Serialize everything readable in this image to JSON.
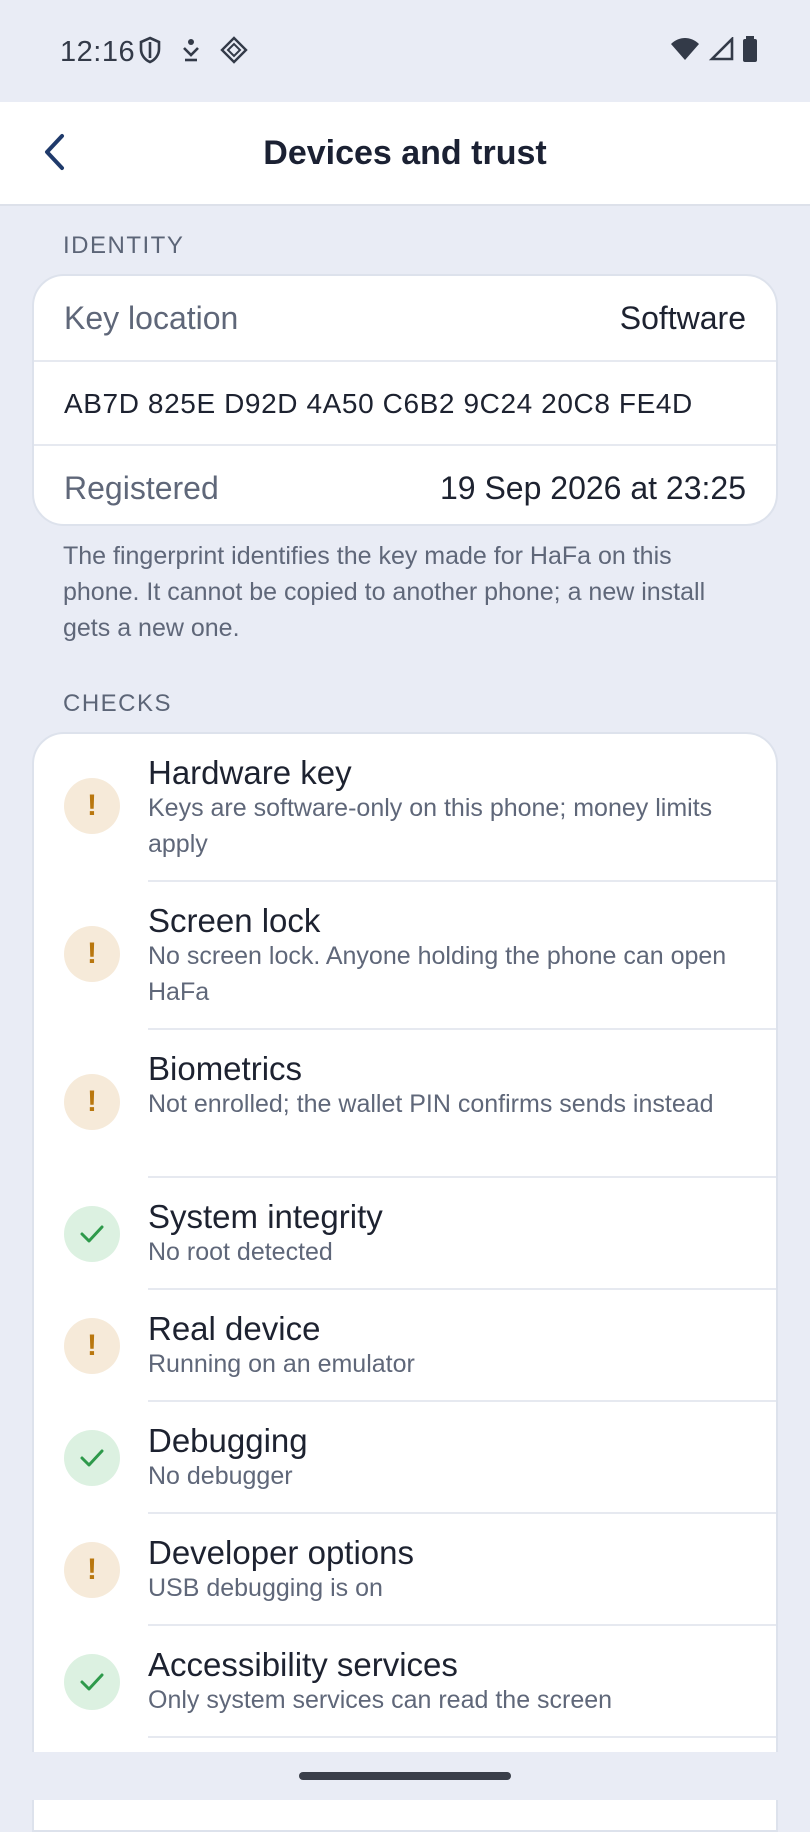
{
  "status_bar": {
    "time": "12:16",
    "left_icons": [
      "shield-icon",
      "download-icon",
      "diamond-icon"
    ],
    "right_icons": [
      "wifi-icon",
      "signal-icon",
      "battery-icon"
    ]
  },
  "app_bar": {
    "title": "Devices and trust",
    "back_icon": "chevron-left-icon"
  },
  "identity": {
    "header": "IDENTITY",
    "key_location_label": "Key location",
    "key_location_value": "Software",
    "fingerprint": "AB7D 825E D92D 4A50 C6B2 9C24 20C8 FE4D",
    "registered_label": "Registered",
    "registered_value": "19 Sep 2026 at 23:25",
    "note": "The fingerprint identifies the key made for HaFa on this phone. It cannot be copied to another phone; a new install gets a new one."
  },
  "checks": {
    "header": "CHECKS",
    "items": [
      {
        "title": "Hardware key",
        "desc": "Keys are software-only on this phone; money limits apply",
        "status": "warning"
      },
      {
        "title": "Screen lock",
        "desc": "No screen lock. Anyone holding the phone can open HaFa",
        "status": "warning"
      },
      {
        "title": "Biometrics",
        "desc": "Not enrolled; the wallet PIN confirms sends instead",
        "status": "warning"
      },
      {
        "title": "System integrity",
        "desc": "No root detected",
        "status": "ok"
      },
      {
        "title": "Real device",
        "desc": "Running on an emulator",
        "status": "warning"
      },
      {
        "title": "Debugging",
        "desc": "No debugger",
        "status": "ok"
      },
      {
        "title": "Developer options",
        "desc": "USB debugging is on",
        "status": "warning"
      },
      {
        "title": "Accessibility services",
        "desc": "Only system services can read the screen",
        "status": "ok"
      }
    ]
  },
  "colors": {
    "warning": "#b9770e",
    "ok": "#2e9a4b",
    "background": "#e9ecf5"
  }
}
